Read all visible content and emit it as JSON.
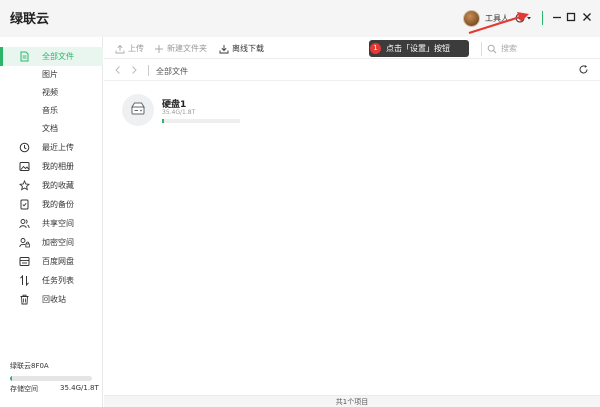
{
  "app": {
    "title": "绿联云"
  },
  "user": {
    "name": "工具人"
  },
  "toolbar": {
    "upload_label": "上传",
    "new_folder_label": "新建文件夹",
    "offline_download_label": "离线下载",
    "search_placeholder": "搜索"
  },
  "tooltip": {
    "badge": "1",
    "text": "点击「设置」按钮"
  },
  "sidebar": {
    "items": [
      {
        "label": "全部文件",
        "icon": "file-icon",
        "active": true
      },
      {
        "label": "图片",
        "icon": "",
        "active": false
      },
      {
        "label": "视频",
        "icon": "",
        "active": false
      },
      {
        "label": "音乐",
        "icon": "",
        "active": false
      },
      {
        "label": "文档",
        "icon": "",
        "active": false
      },
      {
        "label": "最近上传",
        "icon": "clock-icon",
        "active": false
      },
      {
        "label": "我的相册",
        "icon": "album-icon",
        "active": false
      },
      {
        "label": "我的收藏",
        "icon": "star-icon",
        "active": false
      },
      {
        "label": "我的备份",
        "icon": "backup-icon",
        "active": false
      },
      {
        "label": "共享空间",
        "icon": "share-users-icon",
        "active": false
      },
      {
        "label": "加密空间",
        "icon": "lock-user-icon",
        "active": false
      },
      {
        "label": "百度网盘",
        "icon": "baidu-disk-icon",
        "active": false
      },
      {
        "label": "任务列表",
        "icon": "transfer-icon",
        "active": false
      },
      {
        "label": "回收站",
        "icon": "trash-icon",
        "active": false
      }
    ],
    "device_name": "绿联云8F0A",
    "storage_label": "存储空间",
    "storage_value": "35.4G/1.8T",
    "storage_fraction": 0.0197
  },
  "breadcrumb": {
    "current": "全部文件"
  },
  "drives": [
    {
      "name": "硬盘1",
      "size": "35.4G/1.8T",
      "fraction": 0.0197
    }
  ],
  "status": {
    "text": "共1个项目"
  },
  "colors": {
    "accent": "#2ab56a",
    "tooltip_bg": "#3c3c3c",
    "badge": "#e53935",
    "arrow": "#e53935"
  }
}
